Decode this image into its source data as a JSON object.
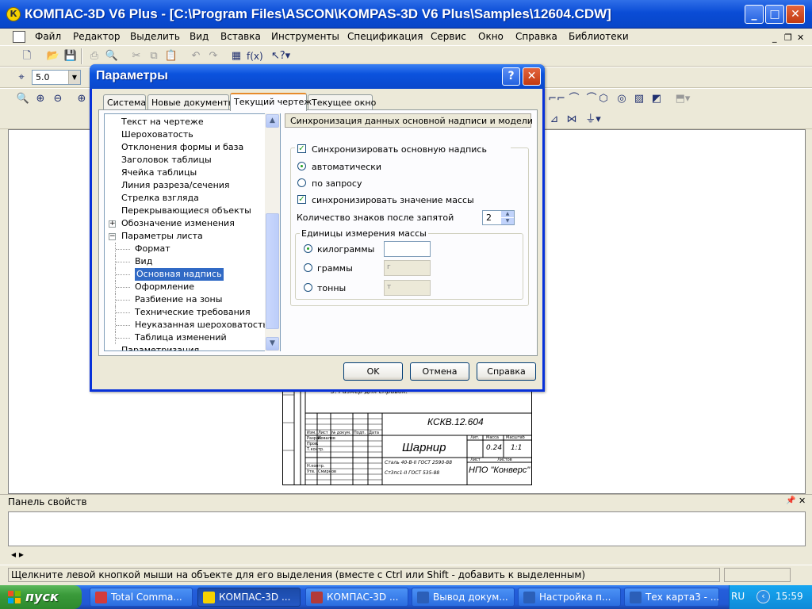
{
  "window": {
    "title": "КОМПАС-3D V6 Plus - [C:\\Program Files\\ASCON\\KOMPAS-3D V6 Plus\\Samples\\12604.CDW]",
    "app_icon_letter": "К"
  },
  "menu": [
    "Файл",
    "Редактор",
    "Выделить",
    "Вид",
    "Вставка",
    "Инструменты",
    "Спецификация",
    "Сервис",
    "Окно",
    "Справка",
    "Библиотеки"
  ],
  "toolbar": {
    "step_value": "5.0"
  },
  "dialog": {
    "title": "Параметры",
    "tabs": [
      "Система",
      "Новые документы",
      "Текущий чертеж",
      "Текущее окно"
    ],
    "active_tab": "Текущий чертеж",
    "tree": [
      {
        "label": "Текст на чертеже",
        "level": 0
      },
      {
        "label": "Шероховатость",
        "level": 0
      },
      {
        "label": "Отклонения формы и база",
        "level": 0
      },
      {
        "label": "Заголовок таблицы",
        "level": 0
      },
      {
        "label": "Ячейка таблицы",
        "level": 0
      },
      {
        "label": "Линия разреза/сечения",
        "level": 0
      },
      {
        "label": "Стрелка взгляда",
        "level": 0
      },
      {
        "label": "Перекрывающиеся объекты",
        "level": 0
      },
      {
        "label": "Обозначение изменения",
        "level": 0,
        "expander": "+"
      },
      {
        "label": "Параметры листа",
        "level": 0,
        "expander": "−"
      },
      {
        "label": "Формат",
        "level": 1
      },
      {
        "label": "Вид",
        "level": 1
      },
      {
        "label": "Основная надпись",
        "level": 1,
        "selected": true
      },
      {
        "label": "Оформление",
        "level": 1
      },
      {
        "label": "Разбиение на зоны",
        "level": 1
      },
      {
        "label": "Технические требования",
        "level": 1
      },
      {
        "label": "Неуказанная шероховатость",
        "level": 1
      },
      {
        "label": "Таблица изменений",
        "level": 1
      },
      {
        "label": "Параметризация",
        "level": 0
      }
    ],
    "section_title": "Синхронизация данных основной надписи и модели",
    "sync_label": "Синхронизировать основную надпись",
    "sync_checked": true,
    "auto_label": "автоматически",
    "auto_selected": true,
    "request_label": "по запросу",
    "request_selected": false,
    "mass_sync_label": "синхронизировать значение массы",
    "mass_sync_checked": true,
    "decimals_label": "Количество знаков после запятой",
    "decimals_value": "2",
    "units_group_label": "Единицы измерения массы",
    "units": [
      {
        "label": "килограммы",
        "selected": true,
        "field": ""
      },
      {
        "label": "граммы",
        "selected": false,
        "field": "г"
      },
      {
        "label": "тонны",
        "selected": false,
        "field": "т"
      }
    ],
    "buttons": {
      "ok": "OK",
      "cancel": "Отмена",
      "help": "Справка"
    }
  },
  "drawing": {
    "note_fragment": "3. Размер для справок.",
    "designation": "КСКВ.12.604",
    "name": "Шарнир",
    "lit_header": "Лит.",
    "mass_header": "Масса",
    "scale_header": "Масштаб",
    "mass": "0.24",
    "scale": "1:1",
    "material_line1": "Сталь 40-В-II ГОСТ 2590-88",
    "material_line2": "Ст3пс1-II ГОСТ 535-88",
    "sheet_label": "Лист",
    "sheets_label": "Листов",
    "company": "НПО \"Конверс\"",
    "row_labels": [
      "Изм.",
      "Лист",
      "№ докум.",
      "Подп.",
      "Дата",
      "Разраб.",
      "Пров.",
      "Т.контр.",
      "Н.контр.",
      "Утв."
    ],
    "row_names": [
      "Ковалев",
      "Смирнов"
    ]
  },
  "properties_panel": {
    "title": "Панель свойств",
    "nav": "◂ ▸"
  },
  "status": {
    "text": "Щелкните левой кнопкой мыши на объекте для его выделения (вместе с Ctrl или Shift - добавить к выделенным)"
  },
  "taskbar": {
    "start_label": "пуск",
    "buttons": [
      {
        "label": "Total Comma...",
        "icon_color": "#d23b3b",
        "active": false
      },
      {
        "label": "КОМПАС-3D ...",
        "icon_color": "#f6d200",
        "active": true
      },
      {
        "label": "КОМПАС-3D ...",
        "icon_color": "#b13a3a",
        "active": false
      },
      {
        "label": "Вывод докум...",
        "icon_color": "#2b5fb8",
        "active": false
      },
      {
        "label": "Настройка п...",
        "icon_color": "#2b5fb8",
        "active": false
      },
      {
        "label": "Тех карта3 - ...",
        "icon_color": "#2b5fb8",
        "active": false
      }
    ],
    "lang": "RU",
    "clock": "15:59"
  }
}
